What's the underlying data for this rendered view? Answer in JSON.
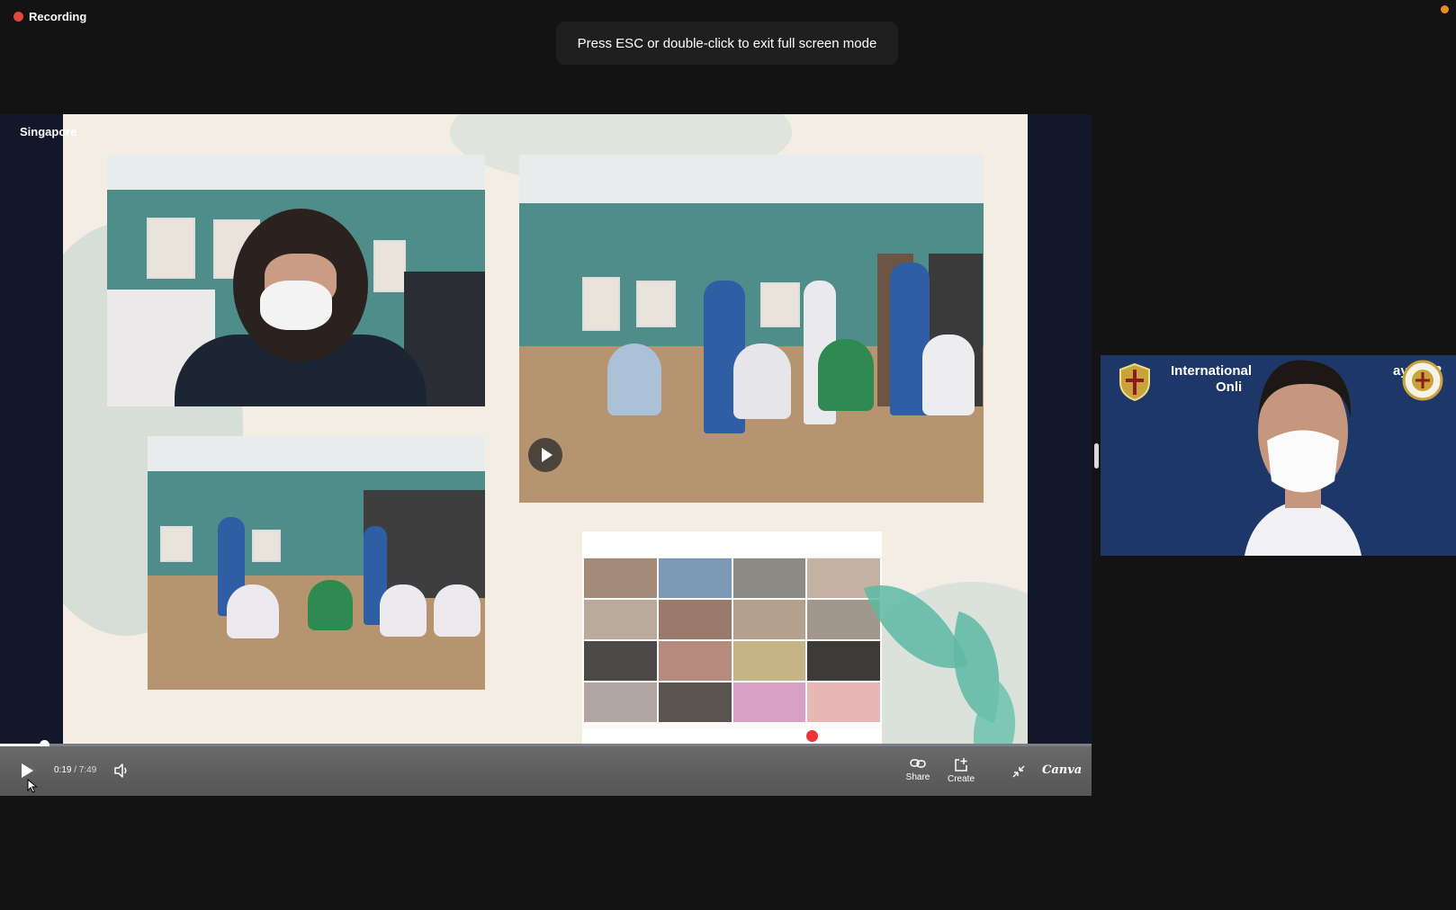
{
  "recording": {
    "label": "Recording"
  },
  "toast": {
    "message": "Press ESC or double-click to exit full screen mode"
  },
  "share": {
    "location_label": "Singapore"
  },
  "player": {
    "current_time": "0:19",
    "separator": " / ",
    "total_time": "7:49",
    "progress_percent": 4.0,
    "share_label": "Share",
    "create_label": "Create",
    "brand": "Canva"
  },
  "speaker": {
    "background_title_line1": "International",
    "background_title_suffix": "ay 2022",
    "background_title_line2": "Onli"
  },
  "colors": {
    "recording_dot": "#e5453b",
    "status_dot": "#f08a1e",
    "speaker_background": "#1d3868"
  }
}
